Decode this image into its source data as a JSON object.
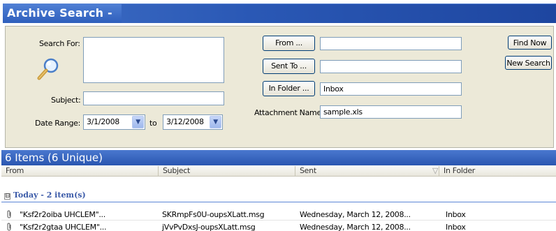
{
  "window": {
    "title": "Archive Search -"
  },
  "search": {
    "search_for_label": "Search For:",
    "search_for_value": "",
    "subject_label": "Subject:",
    "subject_value": "",
    "date_range_label": "Date Range:",
    "date_from": "3/1/2008",
    "date_to_label": "to",
    "date_to": "3/12/2008",
    "from_button": "From ...",
    "from_value": "",
    "sent_to_button": "Sent To ...",
    "sent_to_value": "",
    "in_folder_button": "In Folder ...",
    "in_folder_value": "Inbox",
    "attachment_label": "Attachment Name:",
    "attachment_value": "sample.xls",
    "find_now": "Find Now",
    "new_search": "New Search"
  },
  "results": {
    "summary": "6 Items (6 Unique)",
    "columns": [
      "From",
      "Subject",
      "Sent",
      "In Folder"
    ],
    "sort_indicator": "▽",
    "group": {
      "expander": "⊟",
      "label": "Today - 2 item(s)"
    },
    "rows": [
      {
        "from": "\"Ksf2r2oiba UHCLEM\"...",
        "subject": "SKRmpFs0U-oupsXLatt.msg",
        "sent": "Wednesday, March 12, 2008...",
        "folder": "Inbox"
      },
      {
        "from": "\"Ksf2r2gtaa UHCLEM\"...",
        "subject": "jVvPvDxsJ-oupsXLatt.msg",
        "sent": "Wednesday, March 12, 2008...",
        "folder": "Inbox"
      }
    ]
  },
  "icons": {
    "search": "magnifier-icon",
    "attachment": "paperclip-icon",
    "dropdown": "chevron-down-icon"
  },
  "colors": {
    "title_bar": "#2a58b5",
    "panel": "#ece9d8",
    "results_bar": "#3a66c0",
    "group_text": "#3a5aa8"
  }
}
